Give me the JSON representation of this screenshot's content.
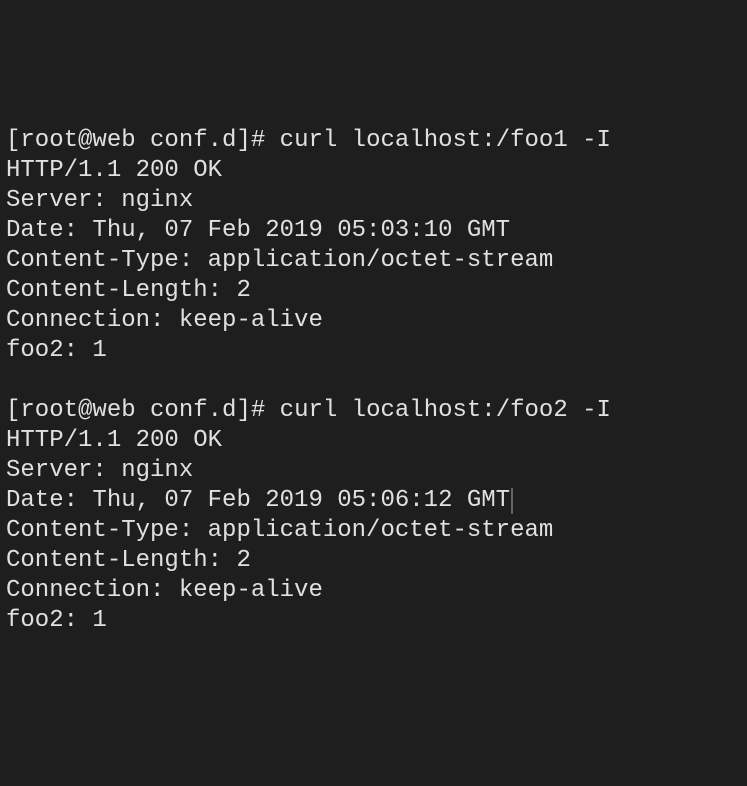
{
  "blocks": [
    {
      "prompt": {
        "open": "[",
        "userhost": "root@web",
        "space1": " ",
        "cwd": "conf.d",
        "close": "]",
        "symbol": "#",
        "space2": " "
      },
      "command": "curl localhost:/foo1 -I",
      "response": [
        "HTTP/1.1 200 OK",
        "Server: nginx",
        "Date: Thu, 07 Feb 2019 05:03:10 GMT",
        "Content-Type: application/octet-stream",
        "Content-Length: 2",
        "Connection: keep-alive",
        "foo2: 1"
      ]
    },
    {
      "prompt": {
        "open": "[",
        "userhost": "root@web",
        "space1": " ",
        "cwd": "conf.d",
        "close": "]",
        "symbol": "#",
        "space2": " "
      },
      "command": "curl localhost:/foo2 -I",
      "response": [
        "HTTP/1.1 200 OK",
        "Server: nginx",
        "Date: Thu, 07 Feb 2019 05:06:12 GMT",
        "Content-Type: application/octet-stream",
        "Content-Length: 2",
        "Connection: keep-alive",
        "foo2: 1"
      ]
    }
  ],
  "blank_line": ""
}
